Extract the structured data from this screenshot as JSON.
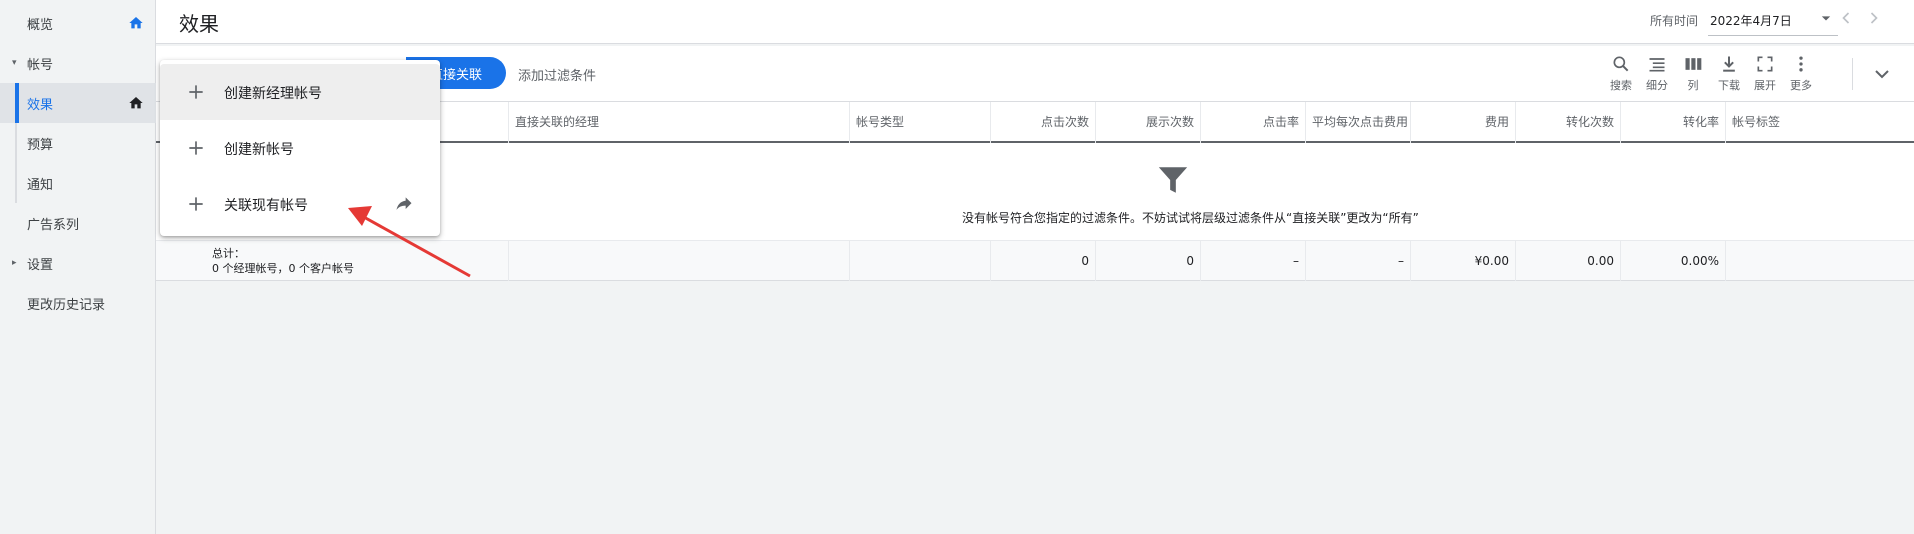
{
  "sidebar": {
    "items": [
      {
        "label": "概览"
      },
      {
        "label": "帐号"
      },
      {
        "label": "效果"
      },
      {
        "label": "预算"
      },
      {
        "label": "通知"
      },
      {
        "label": "广告系列"
      },
      {
        "label": "设置"
      },
      {
        "label": "更改历史记录"
      }
    ]
  },
  "header": {
    "title": "效果",
    "date_label": "所有时间",
    "date_value": "2022年4月7日"
  },
  "toolbar": {
    "filter_chip": "直接关联",
    "add_filter": "添加过滤条件",
    "tools": [
      {
        "label": "搜索",
        "icon": "search-icon"
      },
      {
        "label": "细分",
        "icon": "segment-icon"
      },
      {
        "label": "列",
        "icon": "columns-icon"
      },
      {
        "label": "下载",
        "icon": "download-icon"
      },
      {
        "label": "展开",
        "icon": "expand-icon"
      },
      {
        "label": "更多",
        "icon": "more-vert-icon"
      }
    ]
  },
  "table": {
    "columns": [
      "直接关联的经理",
      "帐号类型",
      "点击次数",
      "展示次数",
      "点击率",
      "平均每次点击费用",
      "费用",
      "转化次数",
      "转化率",
      "帐号标签"
    ],
    "empty_message": "没有帐号符合您指定的过滤条件。不妨试试将层级过滤条件从“直接关联”更改为“所有”",
    "total": {
      "label": "总计：",
      "sublabel": "0 个经理帐号，0 个客户帐号",
      "values": [
        "0",
        "0",
        "–",
        "–",
        "¥0.00",
        "0.00",
        "0.00%"
      ]
    }
  },
  "menu": {
    "items": [
      {
        "label": "创建新经理帐号"
      },
      {
        "label": "创建新帐号"
      },
      {
        "label": "关联现有帐号"
      }
    ]
  },
  "colors": {
    "accent": "#1a73e8",
    "annotation_arrow": "#e53935"
  }
}
